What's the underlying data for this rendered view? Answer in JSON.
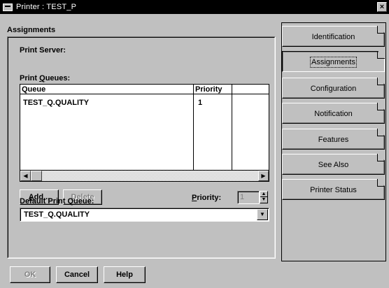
{
  "window": {
    "title": "Printer : TEST_P",
    "close_glyph": "×"
  },
  "section": {
    "heading": "Assignments"
  },
  "print_server": {
    "label": "Print Server:"
  },
  "print_queues": {
    "label_pre": "Print ",
    "label_accel": "Q",
    "label_post": "ueues:",
    "columns": {
      "queue": "Queue",
      "priority": "Priority"
    },
    "rows": [
      {
        "queue": "TEST_Q.QUALITY",
        "priority": "1"
      }
    ]
  },
  "buttons": {
    "add_accel": "A",
    "add_rest": "dd...",
    "delete_accel": "D",
    "delete_rest": "elete",
    "ok": "OK",
    "cancel": "Cancel",
    "help": "Help"
  },
  "priority": {
    "label_accel": "P",
    "label_rest": "riority:",
    "value": "1"
  },
  "default_queue": {
    "label_pre": "Def",
    "label_accel": "a",
    "label_post": "ult Print Queue:",
    "value": "TEST_Q.QUALITY"
  },
  "pages": {
    "identification": "Identification",
    "assignments": "Assignments",
    "configuration": "Configuration",
    "notification": "Notification",
    "features": "Features",
    "see_also": "See Also",
    "printer_status": "Printer Status"
  },
  "icons": {
    "scroll_left": "◀",
    "scroll_right": "▶",
    "spin_up": "▲",
    "spin_down": "▼",
    "dropdown": "▼"
  }
}
